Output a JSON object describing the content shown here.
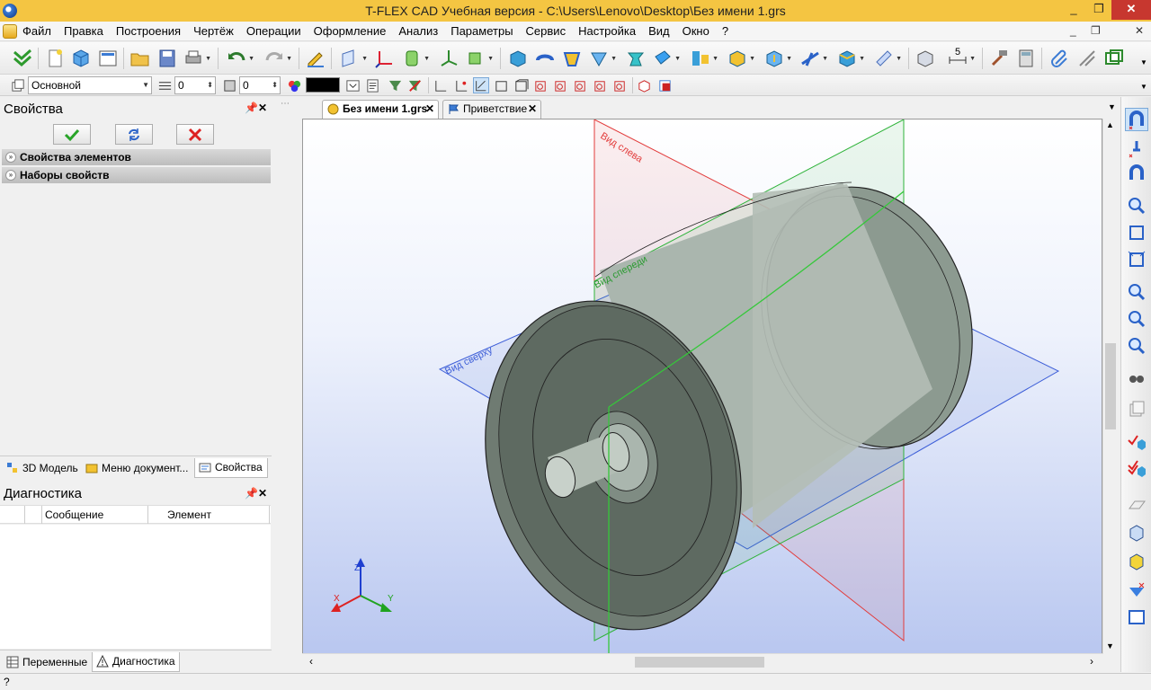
{
  "title": "T-FLEX CAD Учебная версия - C:\\Users\\Lenovo\\Desktop\\Без имени 1.grs",
  "window_controls": {
    "minimize": "_",
    "maximize": "❐",
    "close": "✕"
  },
  "menu": [
    "Файл",
    "Правка",
    "Построения",
    "Чертёж",
    "Операции",
    "Оформление",
    "Анализ",
    "Параметры",
    "Сервис",
    "Настройка",
    "Вид",
    "Окно",
    "?"
  ],
  "mdi_controls": {
    "minimize": "_",
    "restore": "❐",
    "close": "✕"
  },
  "toolbar2": {
    "layer_value": "Основной",
    "level_value": "0",
    "priority_value": "0",
    "color_hex": "#000000"
  },
  "properties_panel": {
    "title": "Свойства",
    "groups": [
      "Свойства элементов",
      "Наборы свойств"
    ]
  },
  "left_tabs": [
    "3D Модель",
    "Меню документ...",
    "Свойства"
  ],
  "diagnostics_panel": {
    "title": "Диагностика",
    "columns": [
      "Сообщение",
      "Элемент"
    ]
  },
  "bottom_tabs": [
    "Переменные",
    "Диагностика"
  ],
  "document_tabs": [
    "Без имени 1.grs",
    "Приветствие"
  ],
  "viewport": {
    "plane_labels": {
      "left": "Вид слева",
      "front": "Вид спереди",
      "top": "Вид сверху"
    },
    "axes": {
      "x": "X",
      "y": "Y",
      "z": "Z"
    }
  },
  "toolbar_step": "5",
  "status_text": "?",
  "colors": {
    "titlebar": "#f4c542",
    "close": "#c7372f",
    "plane_red": "#e23b3b",
    "plane_green": "#2fb33a",
    "plane_blue": "#3d5ed8",
    "body": "#8a978d"
  }
}
